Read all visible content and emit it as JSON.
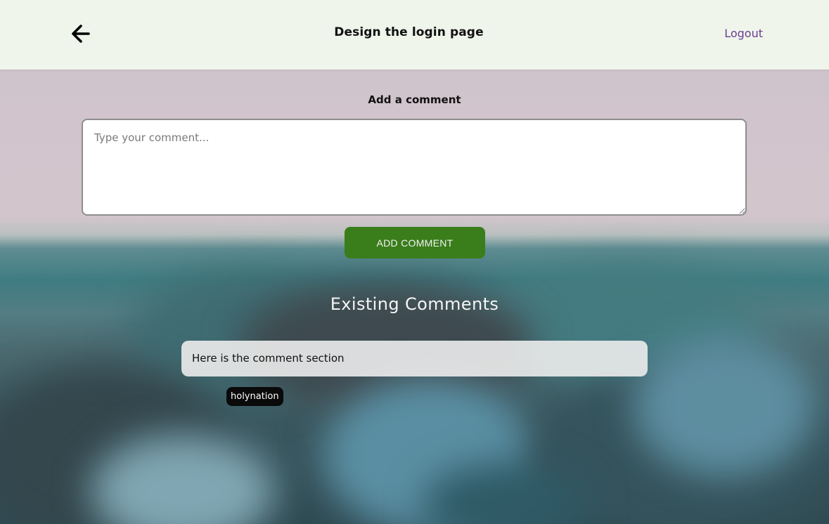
{
  "header": {
    "title": "Design the login page",
    "back_icon": "arrow-left-icon",
    "logout_label": "Logout"
  },
  "new_comment": {
    "label": "Add a comment",
    "placeholder": "Type your comment...",
    "value": "",
    "submit_label": "ADD COMMENT"
  },
  "existing": {
    "title": "Existing Comments",
    "comments": [
      {
        "text": "Here is the comment section",
        "author": "holynation"
      }
    ]
  },
  "colors": {
    "header_bg": "#f0f5ec",
    "logout": "#6a3d8f",
    "button_bg": "#3a7d1b",
    "badge_bg": "#0a0a0a"
  }
}
